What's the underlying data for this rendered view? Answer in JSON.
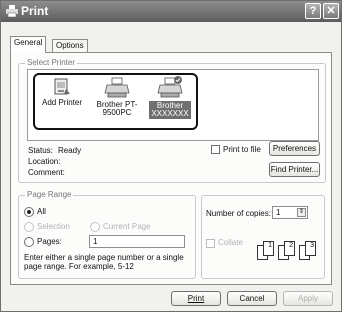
{
  "window": {
    "title": "Print",
    "help_btn": "?",
    "close_btn": "✕"
  },
  "tabs": [
    {
      "label": "General"
    },
    {
      "label": "Options"
    }
  ],
  "select_printer": {
    "group_label": "Select Printer",
    "printers": [
      {
        "label": "Add Printer"
      },
      {
        "label": "Brother PT-9500PC"
      },
      {
        "label": "Brother XXXXXXX"
      }
    ]
  },
  "status": {
    "status_label": "Status:",
    "status_value": "Ready",
    "location_label": "Location:",
    "comment_label": "Comment:",
    "print_to_file": "Print to file",
    "preferences": "Preferences",
    "find_printer": "Find Printer..."
  },
  "page_range": {
    "group_label": "Page Range",
    "all": "All",
    "selection": "Selection",
    "current_page": "Current Page",
    "pages": "Pages:",
    "pages_value": "1",
    "help_text": "Enter either a single page number or a single page range.  For example, 5-12",
    "selected": "All"
  },
  "copies": {
    "label": "Number of copies:",
    "value": "1",
    "collate": "Collate",
    "pages": [
      "1",
      "1",
      "2",
      "2",
      "3",
      "3"
    ]
  },
  "buttons": {
    "print": "Print",
    "cancel": "Cancel",
    "apply": "Apply"
  }
}
